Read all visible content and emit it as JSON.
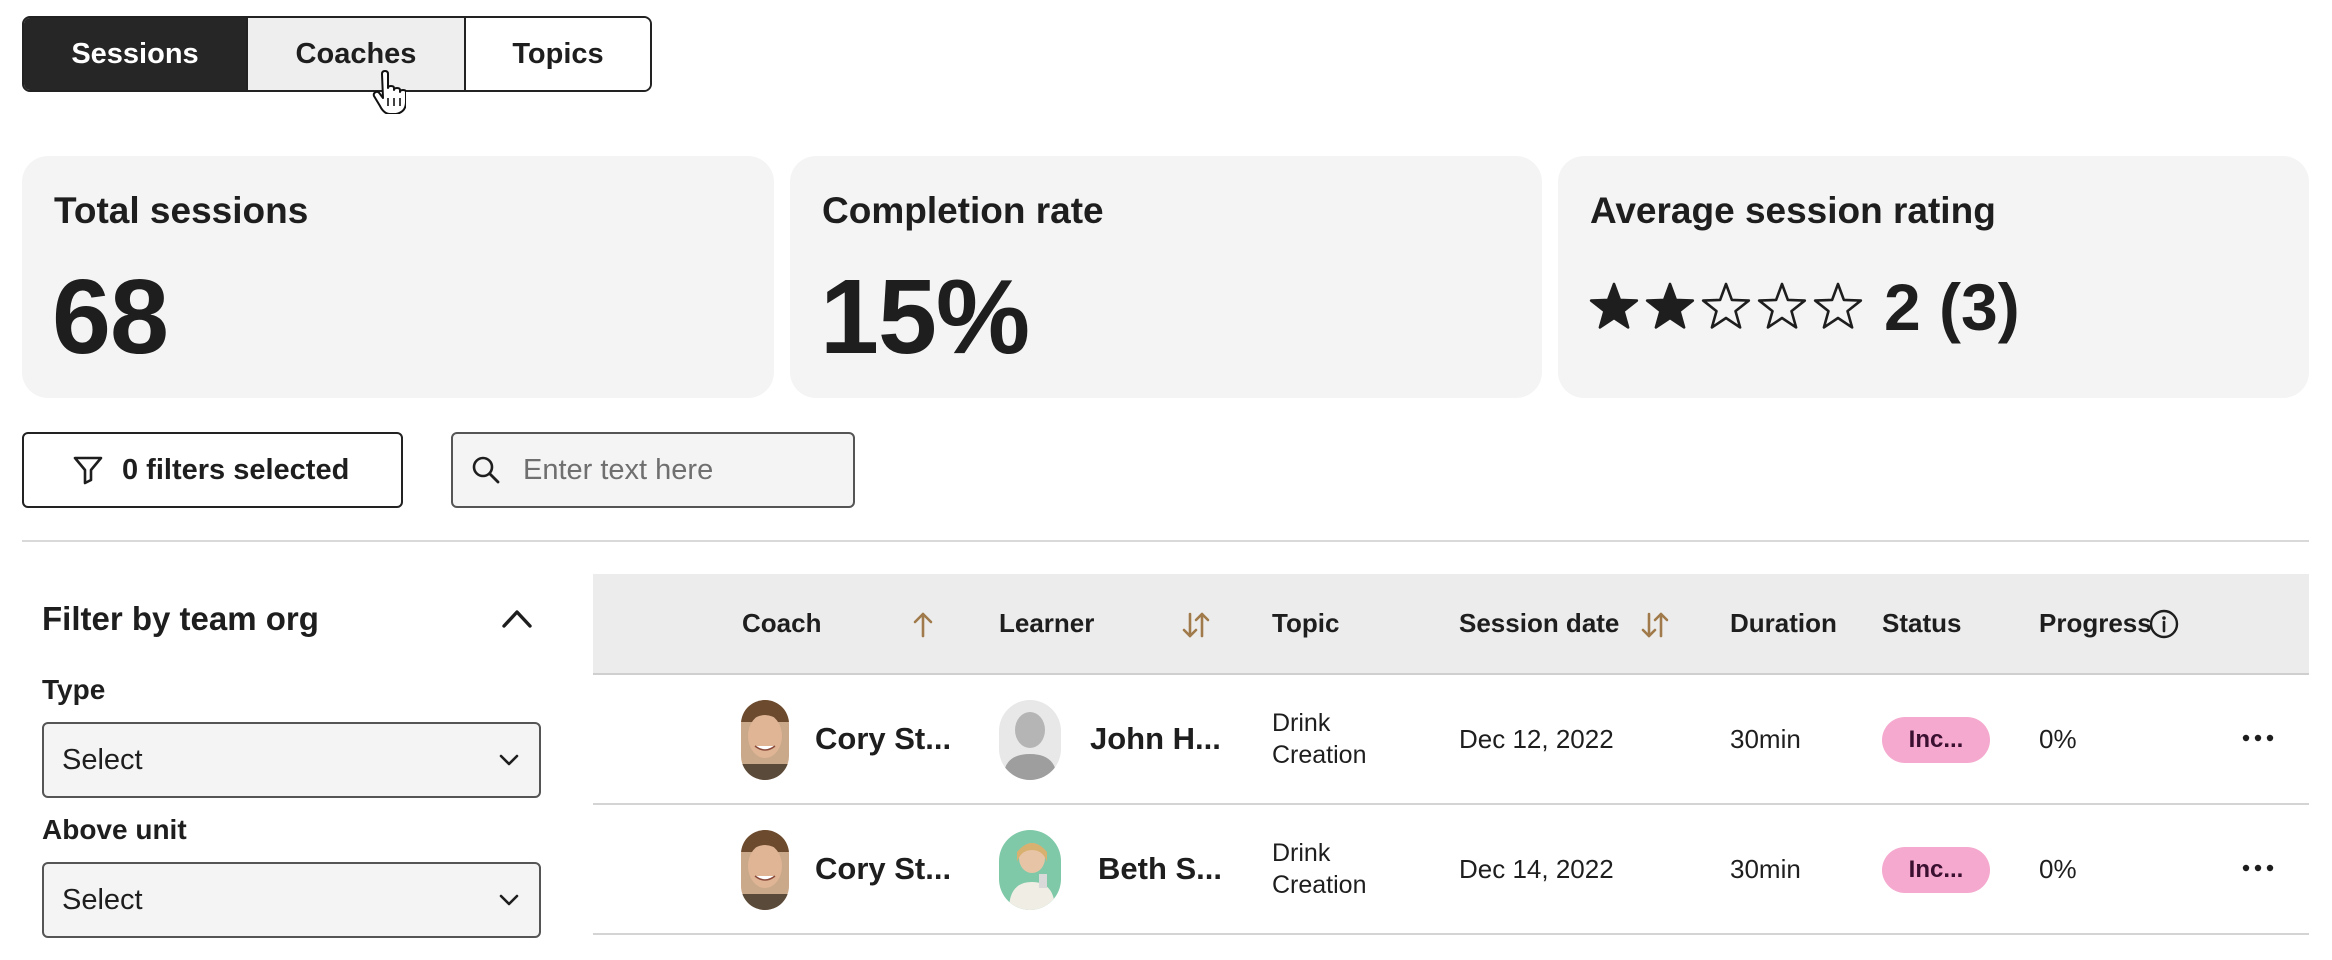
{
  "tabs": [
    {
      "label": "Sessions",
      "active": true
    },
    {
      "label": "Coaches",
      "active": false
    },
    {
      "label": "Topics",
      "active": false
    }
  ],
  "metrics": {
    "total_sessions": {
      "title": "Total sessions",
      "value": "68"
    },
    "completion_rate": {
      "title": "Completion rate",
      "value": "15%"
    },
    "average_rating": {
      "title": "Average session rating",
      "stars_filled": 2,
      "stars_total": 5,
      "value": "2 (3)"
    }
  },
  "filters_button": {
    "label": "0 filters selected",
    "icon": "filter-icon"
  },
  "search": {
    "placeholder": "Enter text here",
    "icon": "search-icon"
  },
  "filter_panel": {
    "title": "Filter by team org",
    "fields": [
      {
        "label": "Type",
        "value": "Select"
      },
      {
        "label": "Above unit",
        "value": "Select"
      }
    ]
  },
  "table": {
    "columns": {
      "coach": "Coach",
      "learner": "Learner",
      "topic": "Topic",
      "session_date": "Session date",
      "duration": "Duration",
      "status": "Status",
      "progress": "Progress"
    },
    "rows": [
      {
        "coach": "Cory St...",
        "learner": "John H...",
        "topic_line1": "Drink",
        "topic_line2": "Creation",
        "date": "Dec 12, 2022",
        "duration": "30min",
        "status": "Inc...",
        "progress": "0%"
      },
      {
        "coach": "Cory St...",
        "learner": "Beth S...",
        "topic_line1": "Drink",
        "topic_line2": "Creation",
        "date": "Dec 14, 2022",
        "duration": "30min",
        "status": "Inc...",
        "progress": "0%"
      }
    ]
  },
  "colors": {
    "active_tab": "#262626",
    "sort_icon": "#a07a4a",
    "status_badge": "#f5a9cf",
    "card_bg": "#f4f4f4"
  }
}
